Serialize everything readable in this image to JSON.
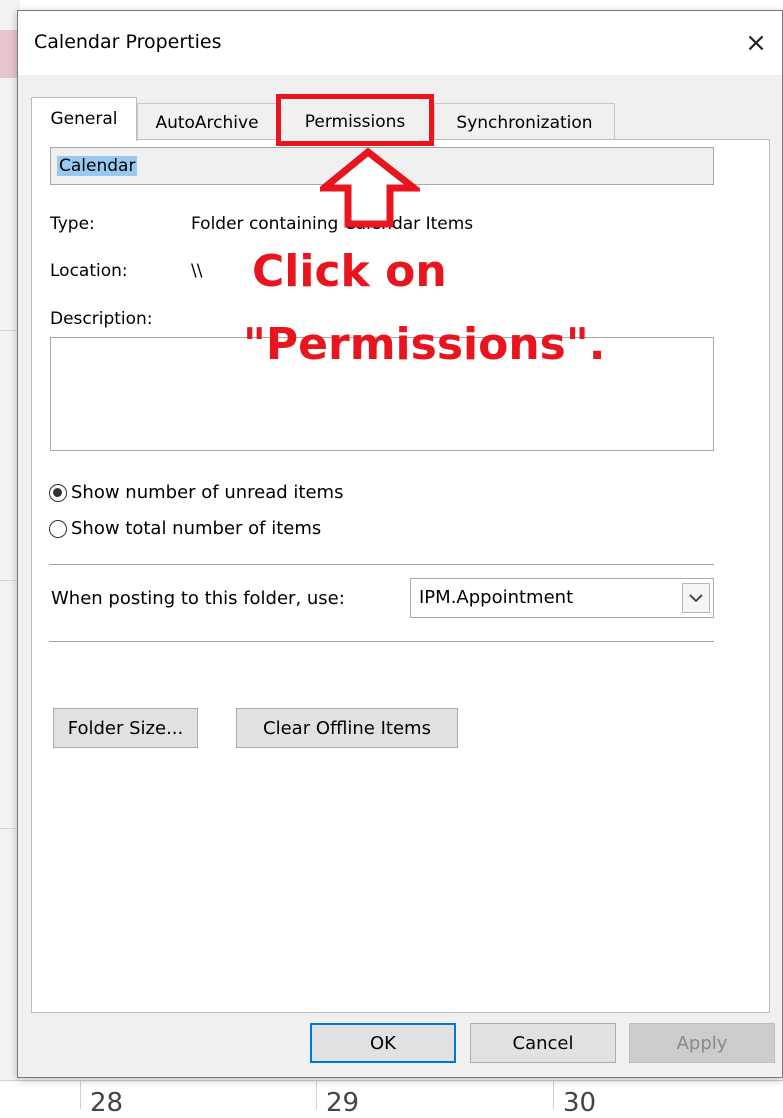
{
  "dialog": {
    "title": "Calendar Properties",
    "close_glyph": "×"
  },
  "tabs": [
    {
      "label": "General",
      "active": true
    },
    {
      "label": "AutoArchive",
      "active": false
    },
    {
      "label": "Permissions",
      "active": false,
      "highlighted": true
    },
    {
      "label": "Synchronization",
      "active": false
    }
  ],
  "general": {
    "folder_name": "Calendar",
    "type_label": "Type:",
    "type_value": "Folder containing Calendar Items",
    "location_label": "Location:",
    "location_value": "\\\\",
    "description_label": "Description:",
    "description_value": "",
    "radio_unread": "Show number of unread items",
    "radio_total": "Show total number of items",
    "radio_selected": "unread",
    "posting_label": "When posting to this folder, use:",
    "posting_value": "IPM.Appointment",
    "folder_size_button": "Folder Size...",
    "clear_offline_button": "Clear Offline Items"
  },
  "footer": {
    "ok": "OK",
    "cancel": "Cancel",
    "apply": "Apply"
  },
  "annotation": {
    "line1": "Click on",
    "line2": "\"Permissions\".",
    "color": "#e8141e"
  },
  "background_calendar": {
    "days": [
      "28",
      "29",
      "30"
    ]
  },
  "icons": {
    "close": "close-icon",
    "dropdown": "chevron-down-icon",
    "arrow": "up-arrow-icon"
  }
}
